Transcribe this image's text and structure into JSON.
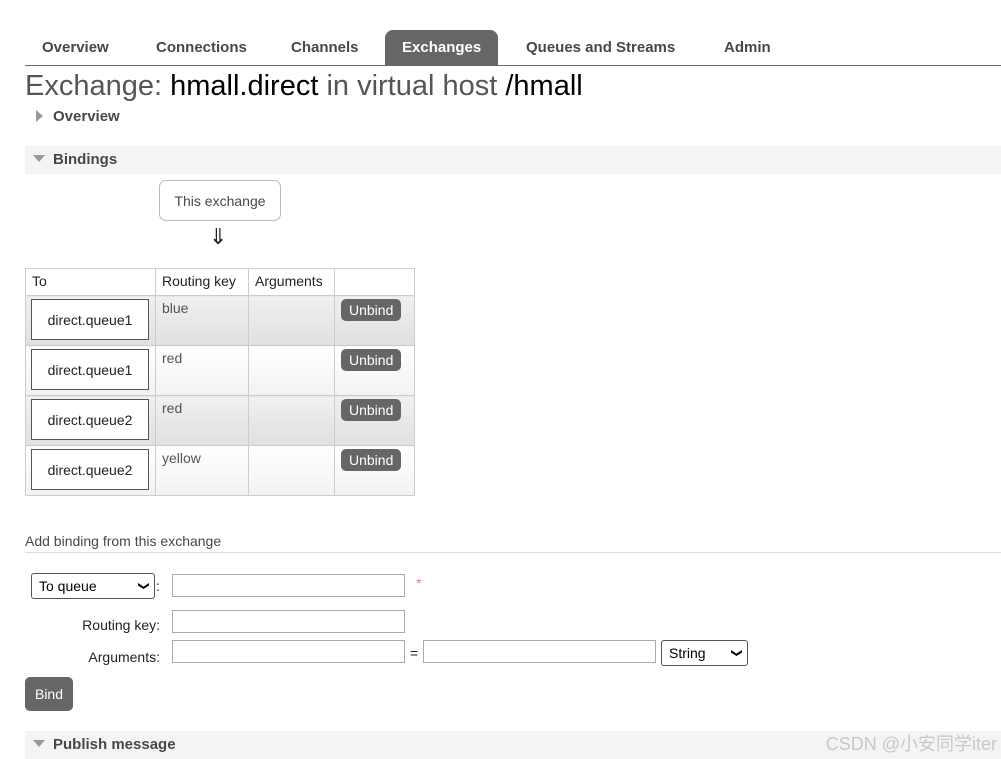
{
  "nav": {
    "tabs": [
      "Overview",
      "Connections",
      "Channels",
      "Exchanges",
      "Queues and Streams",
      "Admin"
    ],
    "active": "Exchanges"
  },
  "title": {
    "prefix": "Exchange: ",
    "exchange": "hmall.direct",
    "middle": " in virtual host ",
    "vhost": "/hmall"
  },
  "sections": {
    "overview": "Overview",
    "bindings": "Bindings",
    "publish": "Publish message"
  },
  "bindings": {
    "this_exchange": "This exchange",
    "arrow": "⇓",
    "headers": [
      "To",
      "Routing key",
      "Arguments",
      ""
    ],
    "rows": [
      {
        "to": "direct.queue1",
        "routing_key": "blue",
        "arguments": "",
        "action": "Unbind"
      },
      {
        "to": "direct.queue1",
        "routing_key": "red",
        "arguments": "",
        "action": "Unbind"
      },
      {
        "to": "direct.queue2",
        "routing_key": "red",
        "arguments": "",
        "action": "Unbind"
      },
      {
        "to": "direct.queue2",
        "routing_key": "yellow",
        "arguments": "",
        "action": "Unbind"
      }
    ]
  },
  "add_binding": {
    "title": "Add binding from this exchange",
    "destination_type": "To queue",
    "colon": ":",
    "required_mark": "*",
    "routing_key_label": "Routing key:",
    "arguments_label": "Arguments:",
    "equals": "=",
    "arg_type": "String",
    "bind_label": "Bind"
  },
  "watermark": "CSDN @小安同学iter"
}
